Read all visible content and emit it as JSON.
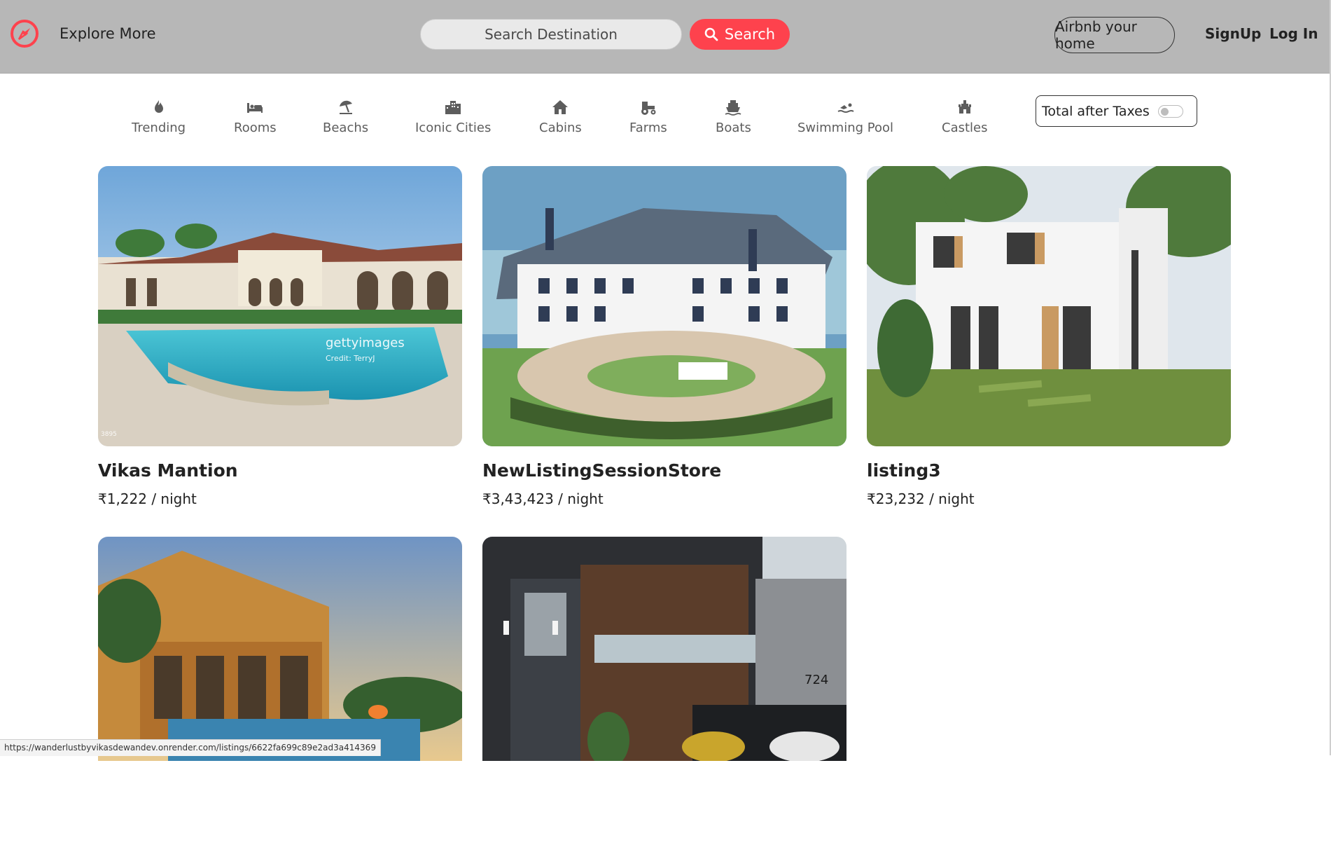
{
  "navbar": {
    "explore_label": "Explore More",
    "search_placeholder": "Search Destination",
    "search_button": "Search",
    "airbnb_home": "Airbnb your home",
    "signup": "SignUp",
    "login": "Log In",
    "brand_color": "#fe424d"
  },
  "filters": [
    {
      "label": "Trending",
      "icon": "fire-icon"
    },
    {
      "label": "Rooms",
      "icon": "bed-icon"
    },
    {
      "label": "Beachs",
      "icon": "umbrella-beach-icon"
    },
    {
      "label": "Iconic Cities",
      "icon": "city-icon"
    },
    {
      "label": "Cabins",
      "icon": "house-icon"
    },
    {
      "label": "Farms",
      "icon": "tractor-icon"
    },
    {
      "label": "Boats",
      "icon": "ship-icon"
    },
    {
      "label": "Swimming Pool",
      "icon": "person-swimming-icon"
    },
    {
      "label": "Castles",
      "icon": "chess-rook-icon"
    }
  ],
  "tax_toggle": {
    "label": "Total after Taxes",
    "enabled": false
  },
  "listings": [
    {
      "title": "Vikas Mantion",
      "price": "₹1,222 / night"
    },
    {
      "title": "NewListingSessionStore",
      "price": "₹3,43,423 / night"
    },
    {
      "title": "listing3",
      "price": "₹23,232 / night"
    },
    {
      "title": "",
      "price": ""
    },
    {
      "title": "",
      "price": ""
    }
  ],
  "image_watermark": {
    "brand": "gettyimages",
    "credit": "Credit: TerryJ",
    "id": "3895"
  },
  "image_house_number": "724",
  "status_bar": {
    "url": "https://wanderlustbyvikasdewandev.onrender.com/listings/6622fa699c89e2ad3a414369"
  }
}
